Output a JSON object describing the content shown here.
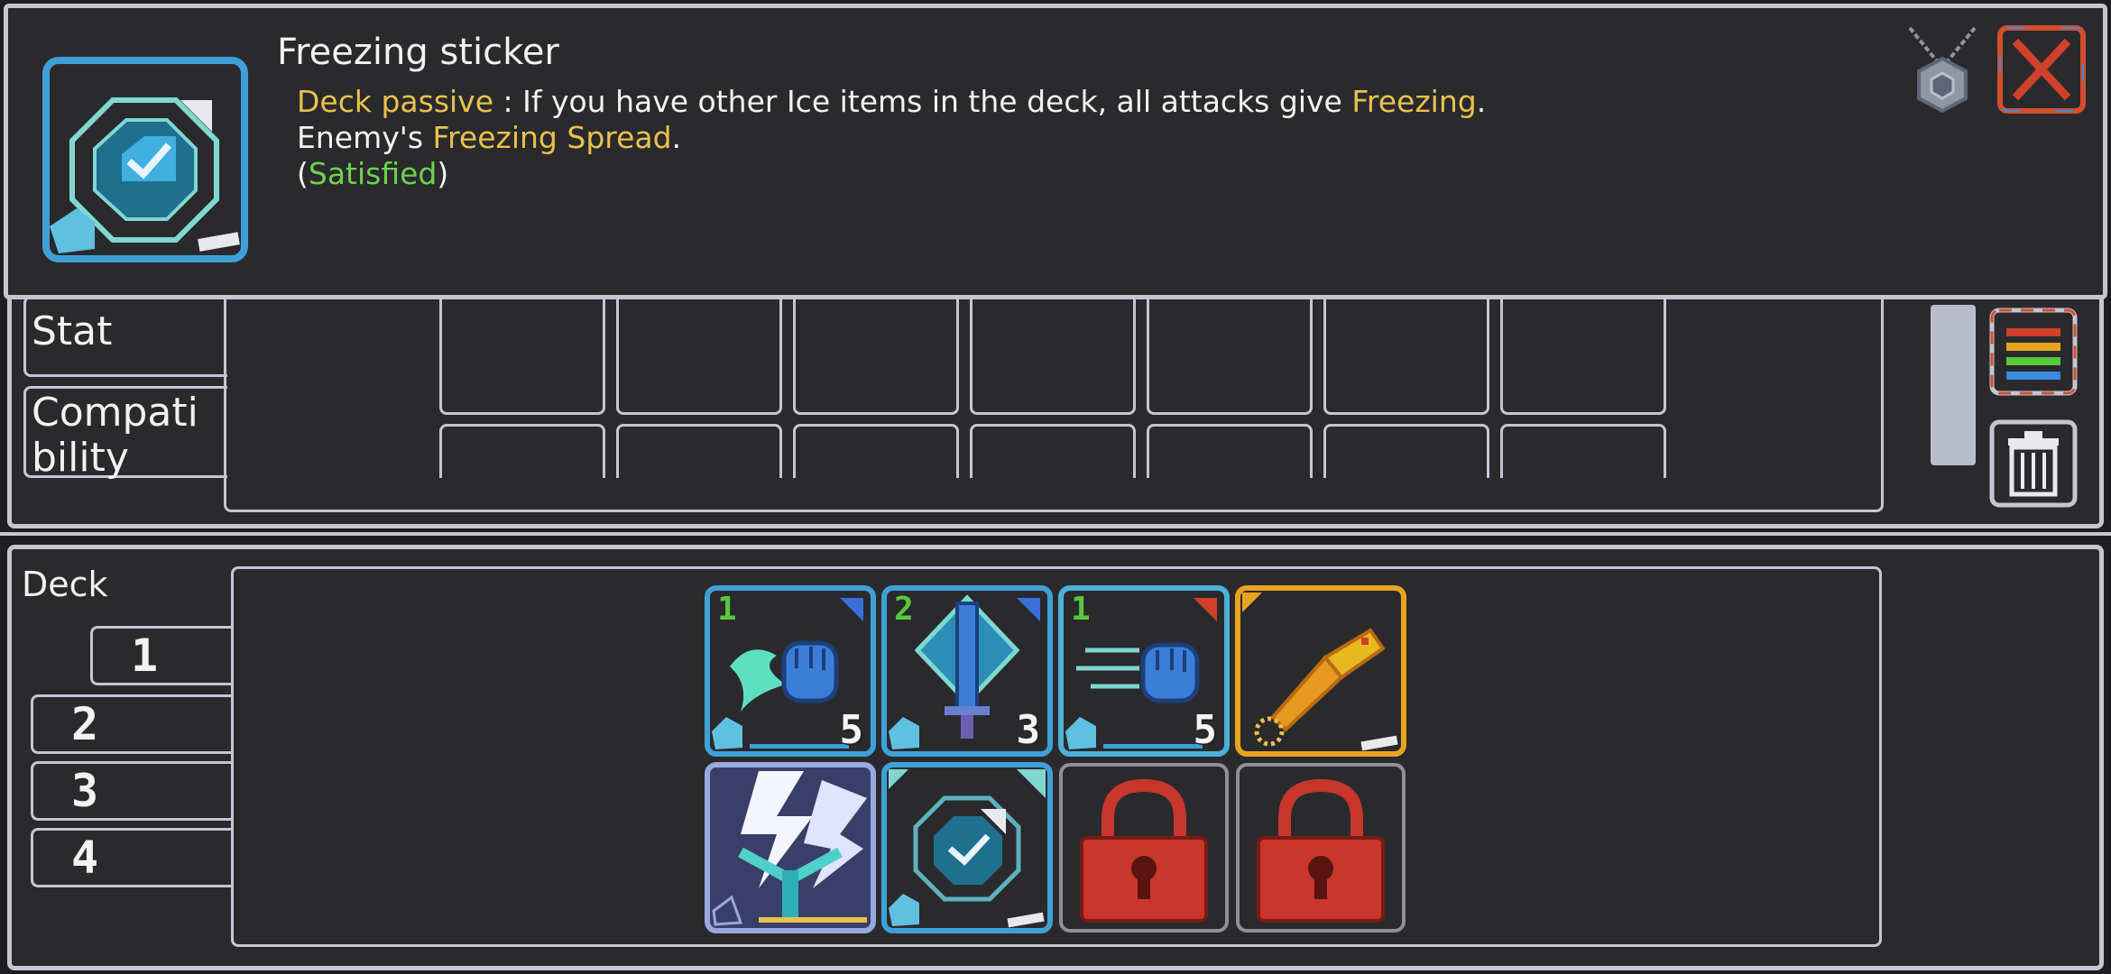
{
  "tooltip": {
    "title": "Freezing sticker",
    "line1_label": "Deck passive",
    "line1_sep": " : ",
    "line1_text": "If you have other Ice items in the deck, all attacks give ",
    "line1_keyword": "Freezing",
    "line1_end": ".",
    "line2_text": "Enemy's ",
    "line2_keyword": "Freezing Spread",
    "line2_end": ".",
    "line3_open": "(",
    "line3_status": "Satisfied",
    "line3_close": ")",
    "icon": "freezing-sticker-icon",
    "amulet_icon": "amulet-icon",
    "close_icon": "close-icon"
  },
  "middle": {
    "tabs": [
      {
        "label": "Stat"
      },
      {
        "label": "Compati\nbility"
      }
    ],
    "tab_line1": "Compati",
    "tab_line2": "bility",
    "sort_icon": "sort-icon",
    "trash_icon": "trash-icon"
  },
  "deck": {
    "label": "Deck",
    "tabs": [
      "1",
      "2",
      "3",
      "4"
    ],
    "cards": [
      {
        "name": "ice-punch-card",
        "cost": "1",
        "count": "5",
        "icon": "fist-icon",
        "border": "#3fa0d8"
      },
      {
        "name": "ice-sword-card",
        "cost": "2",
        "count": "3",
        "icon": "sword-icon",
        "border": "#3fa0d8"
      },
      {
        "name": "ice-dash-punch-card",
        "cost": "1",
        "count": "5",
        "icon": "fist-icon",
        "border": "#4db0d8"
      },
      {
        "name": "gold-wand-card",
        "cost": "",
        "count": "",
        "icon": "wand-icon",
        "border": "#e8a420"
      },
      {
        "name": "lightning-staff-card",
        "cost": "",
        "count": "",
        "icon": "lightning-icon",
        "border": "#9aa8e0"
      },
      {
        "name": "freezing-sticker-card",
        "cost": "",
        "count": "",
        "icon": "sticker-icon",
        "border": "#3fa0d8"
      },
      {
        "name": "locked-slot-card",
        "cost": "",
        "count": "",
        "icon": "lock-icon",
        "border": "#8f8f99"
      },
      {
        "name": "locked-slot-card",
        "cost": "",
        "count": "",
        "icon": "lock-icon",
        "border": "#8f8f99"
      }
    ]
  },
  "colors": {
    "frame": "#c3c6d3",
    "panel": "#2a2a2d",
    "keyword": "#e8c24a",
    "satisfied": "#6ed24c",
    "close": "#d0402a"
  }
}
